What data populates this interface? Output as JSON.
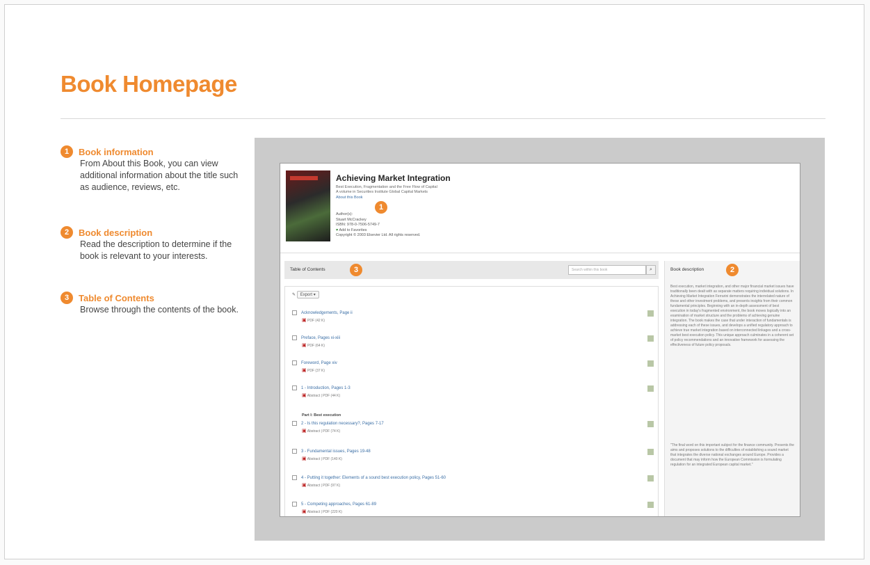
{
  "heading": "Book Homepage",
  "callouts": [
    {
      "num": "1",
      "title": "Book information",
      "desc": "From About this Book, you can view additional information about the title such as audience, reviews, etc."
    },
    {
      "num": "2",
      "title": "Book description",
      "desc": "Read the description to determine if the book is relevant to your interests."
    },
    {
      "num": "3",
      "title": "Table of Contents",
      "desc": "Browse through the contents of the book."
    }
  ],
  "colors": {
    "accent": "#ef8a2f",
    "link": "#3a6ea5"
  },
  "screen": {
    "book_title": "Achieving Market Integration",
    "subtitle": "Best Execution, Fragmentation and the Free Flow of Capital",
    "subtitle2": "A volume in Securities Institute Global Capital Markets",
    "about": "About this Book",
    "authors_label": "Author(s):",
    "author": "Stuart McCrackey",
    "isbn": "ISBN: 978-0-7506-5749-7",
    "favorites": "Add to Favorites",
    "copyright": "Copyright © 2003 Elsevier Ltd. All rights reserved.",
    "toc_label": "Table of Contents",
    "search_placeholder": "Search within this book",
    "export_label": "Export",
    "desc_label": "Book description",
    "toc_items": [
      {
        "title": "Acknowledgements, Page ii",
        "sub": "PDF (42 K)"
      },
      {
        "title": "Preface, Pages xi-xiii",
        "sub": "PDF (64 K)"
      },
      {
        "title": "Foreword, Page xiv",
        "sub": "PDF (37 K)"
      },
      {
        "title": "1 - Introduction, Pages 1-3",
        "sub": "Abstract | PDF (44 K)"
      },
      {
        "title": "2 - Is this regulation necessary?, Pages 7-17",
        "sub": "Abstract | PDF (74 K)"
      },
      {
        "title": "3 - Fundamental issues, Pages 19-48",
        "sub": "Abstract | PDF (140 K)"
      },
      {
        "title": "4 - Putting it together: Elements of a sound best execution policy, Pages 51-60",
        "sub": "Abstract | PDF (97 K)"
      },
      {
        "title": "5 - Competing approaches, Pages 61-89",
        "sub": "Abstract | PDF (220 K)"
      }
    ],
    "part_label": "Part I: Best execution",
    "description": "Best execution, market integration, and other major financial market issues have traditionally been dealt with as separate matters requiring individual solutions. In Achieving Market Integration Ferrarini demonstrates the interrelated nature of these and other investment problems, and presents insights from their common fundamental principles. Beginning with an in-depth assessment of best execution in today's fragmented environment, the book moves logically into an examination of market structure and the problems of achieving genuine integration. The book makes the case that under interaction of fundamentals is addressing each of these issues, and develops a unified regulatory approach to achieve true market integration based on interconnected linkages and a cross-market best execution policy. This unique approach culminates in a coherent set of policy recommendations and an innovative framework for assessing the effectiveness of future policy proposals.",
    "description2": "\"The final word on this important subject for the finance community. Presents the aims and proposes solutions to the difficulties of establishing a sound market that integrates the diverse national exchanges around Europe. Provides a document that may inform how the European Commission is formulating regulation for an integrated European capital market.\""
  }
}
